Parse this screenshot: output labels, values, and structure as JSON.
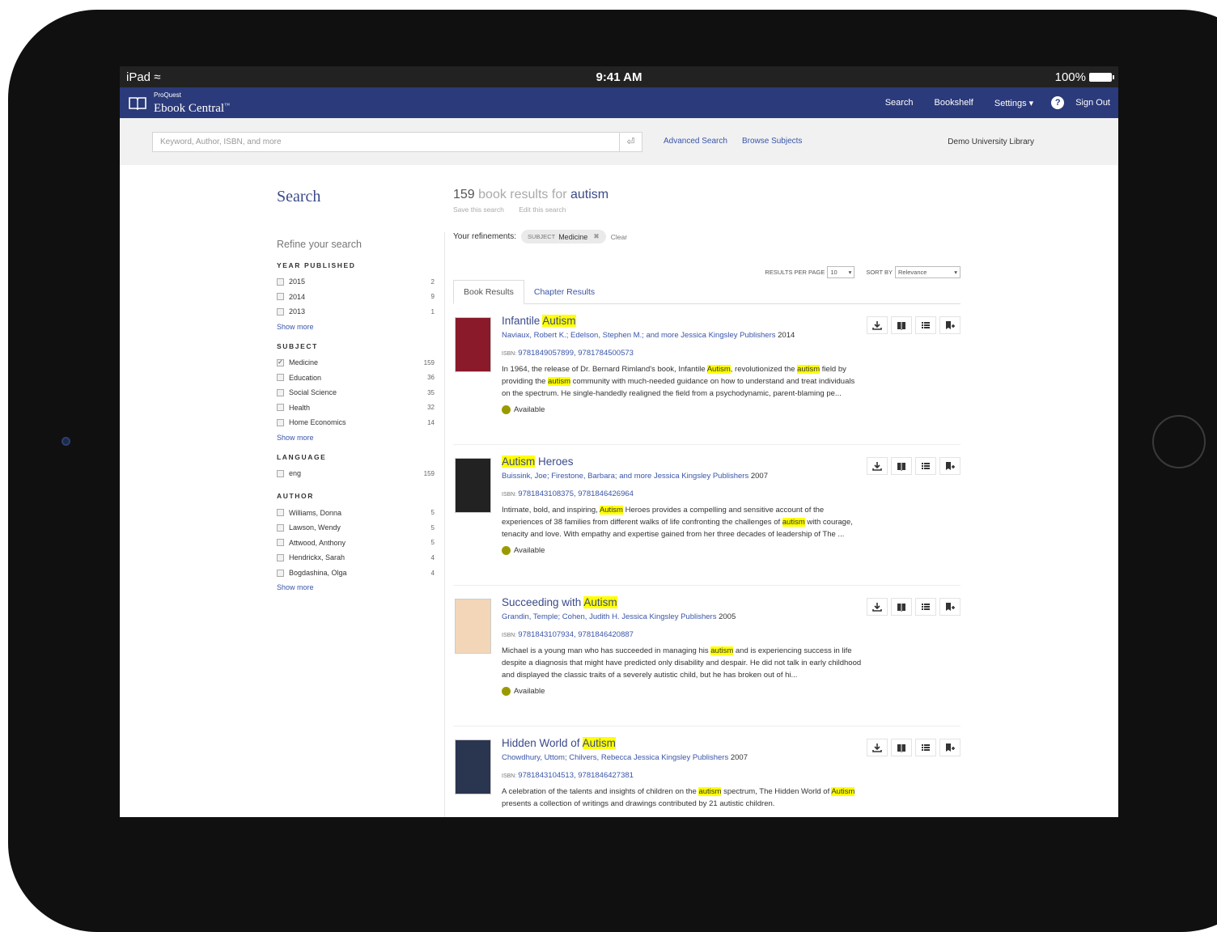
{
  "status": {
    "device": "iPad",
    "time": "9:41 AM",
    "battery": "100%"
  },
  "nav": {
    "brand_top": "ProQuest",
    "brand_main": "Ebook Central",
    "brand_tm": "™",
    "links": [
      "Search",
      "Bookshelf",
      "Settings ▾"
    ],
    "help": "?",
    "signout": "Sign Out",
    "accent": "#2b3a7a"
  },
  "search": {
    "placeholder": "Keyword, Author, ISBN, and more",
    "enter": "⏎",
    "advanced": "Advanced Search",
    "browse": "Browse Subjects",
    "library": "Demo University Library"
  },
  "sidebar": {
    "title": "Search",
    "refine": "Refine your search",
    "groups": [
      {
        "heading": "YEAR PUBLISHED",
        "items": [
          {
            "label": "2015",
            "count": "2",
            "checked": false
          },
          {
            "label": "2014",
            "count": "9",
            "checked": false
          },
          {
            "label": "2013",
            "count": "1",
            "checked": false
          }
        ],
        "more": "Show more"
      },
      {
        "heading": "SUBJECT",
        "items": [
          {
            "label": "Medicine",
            "count": "159",
            "checked": true
          },
          {
            "label": "Education",
            "count": "36",
            "checked": false
          },
          {
            "label": "Social Science",
            "count": "35",
            "checked": false
          },
          {
            "label": "Health",
            "count": "32",
            "checked": false
          },
          {
            "label": "Home Economics",
            "count": "14",
            "checked": false
          }
        ],
        "more": "Show more"
      },
      {
        "heading": "LANGUAGE",
        "items": [
          {
            "label": "eng",
            "count": "159",
            "checked": false
          }
        ],
        "more": ""
      },
      {
        "heading": "AUTHOR",
        "items": [
          {
            "label": "Williams, Donna",
            "count": "5",
            "checked": false
          },
          {
            "label": "Lawson, Wendy",
            "count": "5",
            "checked": false
          },
          {
            "label": "Attwood, Anthony",
            "count": "5",
            "checked": false
          },
          {
            "label": "Hendrickx, Sarah",
            "count": "4",
            "checked": false
          },
          {
            "label": "Bogdashina, Olga",
            "count": "4",
            "checked": false
          }
        ],
        "more": "Show more"
      }
    ]
  },
  "results": {
    "count": "159",
    "label": "book results for",
    "query": "autism",
    "save": "Save this search",
    "edit": "Edit this search",
    "refinements_label": "Your refinements:",
    "chip_key": "SUBJECT",
    "chip_value": "Medicine",
    "chip_remove": "✖",
    "clear": "Clear",
    "per_page_label": "RESULTS PER PAGE",
    "per_page": "10",
    "sort_label": "SORT BY",
    "sort": "Relevance",
    "tabs": [
      "Book Results",
      "Chapter Results"
    ],
    "items": [
      {
        "title_parts": [
          {
            "t": "Infantile ",
            "hl": false
          },
          {
            "t": "Autism",
            "hl": true
          }
        ],
        "authors": "Naviaux, Robert K.; Edelson, Stephen M.; and more",
        "publisher": "Jessica Kingsley Publishers",
        "year": "2014",
        "isbn": "9781849057899, 9781784500573",
        "snippet_parts": [
          {
            "t": "In 1964, the release of Dr. Bernard Rimland's book, Infantile ",
            "hl": false
          },
          {
            "t": "Autism",
            "hl": true
          },
          {
            "t": ", revolutionized the ",
            "hl": false
          },
          {
            "t": "autism",
            "hl": true
          },
          {
            "t": " field by providing the ",
            "hl": false
          },
          {
            "t": "autism",
            "hl": true
          },
          {
            "t": " community with much-needed guidance on how to understand and treat individuals on the spectrum. He single-handedly realigned the field from a psychodynamic, parent-blaming pe...",
            "hl": false
          }
        ],
        "availability": "Available",
        "cover": "#8a1a2a"
      },
      {
        "title_parts": [
          {
            "t": "Autism",
            "hl": true
          },
          {
            "t": " Heroes",
            "hl": false
          }
        ],
        "authors": "Buissink, Joe; Firestone, Barbara; and more",
        "publisher": "Jessica Kingsley Publishers",
        "year": "2007",
        "isbn": "9781843108375, 9781846426964",
        "snippet_parts": [
          {
            "t": "Intimate, bold, and inspiring, ",
            "hl": false
          },
          {
            "t": "Autism",
            "hl": true
          },
          {
            "t": " Heroes provides a compelling and sensitive account of the experiences of 38 families from different walks of life confronting the challenges of ",
            "hl": false
          },
          {
            "t": "autism",
            "hl": true
          },
          {
            "t": " with courage, tenacity and love. With empathy and expertise gained from her three decades of leadership of The ...",
            "hl": false
          }
        ],
        "availability": "Available",
        "cover": "#222222"
      },
      {
        "title_parts": [
          {
            "t": "Succeeding with ",
            "hl": false
          },
          {
            "t": "Autism",
            "hl": true
          }
        ],
        "authors": "Grandin, Temple; Cohen, Judith H.",
        "publisher": "Jessica Kingsley Publishers",
        "year": "2005",
        "isbn": "9781843107934, 9781846420887",
        "snippet_parts": [
          {
            "t": "Michael is a young man who has succeeded in managing his ",
            "hl": false
          },
          {
            "t": "autism",
            "hl": true
          },
          {
            "t": " and is experiencing success in life despite a diagnosis that might have predicted only disability and despair. He did not talk in early childhood and displayed the classic traits of a severely autistic child, but he has broken out of hi...",
            "hl": false
          }
        ],
        "availability": "Available",
        "cover": "#f3d6b8"
      },
      {
        "title_parts": [
          {
            "t": "Hidden World of ",
            "hl": false
          },
          {
            "t": "Autism",
            "hl": true
          }
        ],
        "authors": "Chowdhury, Uttom; Chilvers, Rebecca",
        "publisher": "Jessica Kingsley Publishers",
        "year": "2007",
        "isbn": "9781843104513, 9781846427381",
        "snippet_parts": [
          {
            "t": "A celebration of the talents and insights of children on the ",
            "hl": false
          },
          {
            "t": "autism",
            "hl": true
          },
          {
            "t": " spectrum, The Hidden World of ",
            "hl": false
          },
          {
            "t": "Autism",
            "hl": true
          },
          {
            "t": " presents a collection of writings and drawings contributed by 21 autistic children.",
            "hl": false
          }
        ],
        "availability": "",
        "cover": "#2a3550"
      }
    ]
  }
}
